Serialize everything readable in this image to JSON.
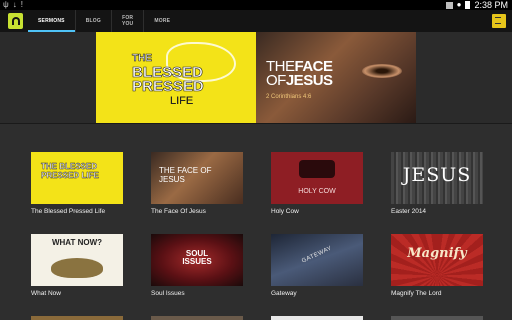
{
  "status_bar": {
    "left_icons": [
      "usb-icon",
      "download-icon",
      "alert-icon"
    ],
    "right_icons": [
      "image-icon",
      "wifi-icon",
      "battery-icon"
    ],
    "time": "2:38 PM"
  },
  "app_bar": {
    "tabs": [
      {
        "label": "SERMONS",
        "active": true
      },
      {
        "label": "BLOG",
        "active": false
      },
      {
        "label": "FOR\nYOU",
        "active": false
      },
      {
        "label": "MORE",
        "active": false
      }
    ],
    "accent_color": "#4fc3f7",
    "logo_color": "#c8e232",
    "menu_button_color": "#e6c51b"
  },
  "hero": {
    "left": {
      "line1": "THE",
      "line2": "BLESSED",
      "line3": "PRESSED",
      "line4": "LIFE"
    },
    "right": {
      "line1": "THE",
      "line1b": "FACE",
      "line2": "OF",
      "line2b": "JESUS",
      "subtitle": "2 Corinthians 4:6"
    }
  },
  "sermons": [
    {
      "title": "The Blessed Pressed Life",
      "thumb_text": "THE BLESSED PRESSED LIFE",
      "color": "#f3e318"
    },
    {
      "title": "The Face Of Jesus",
      "thumb_text": "THE FACE OF JESUS",
      "color": "#7a4a2e"
    },
    {
      "title": "Holy Cow",
      "thumb_text": "HOLY COW",
      "color": "#8e1e24"
    },
    {
      "title": "Easter 2014",
      "thumb_text": "JESUS",
      "color": "#3b3b3b"
    },
    {
      "title": "What Now",
      "thumb_text": "WHAT NOW?",
      "color": "#f4f1e6"
    },
    {
      "title": "Soul Issues",
      "thumb_text": "SOUL ISSUES",
      "color": "#6e1618"
    },
    {
      "title": "Gateway",
      "thumb_text": "GATEWAY",
      "color": "#2c3a52"
    },
    {
      "title": "Magnify The Lord",
      "thumb_text": "Magnify",
      "color": "#a3201d"
    }
  ]
}
